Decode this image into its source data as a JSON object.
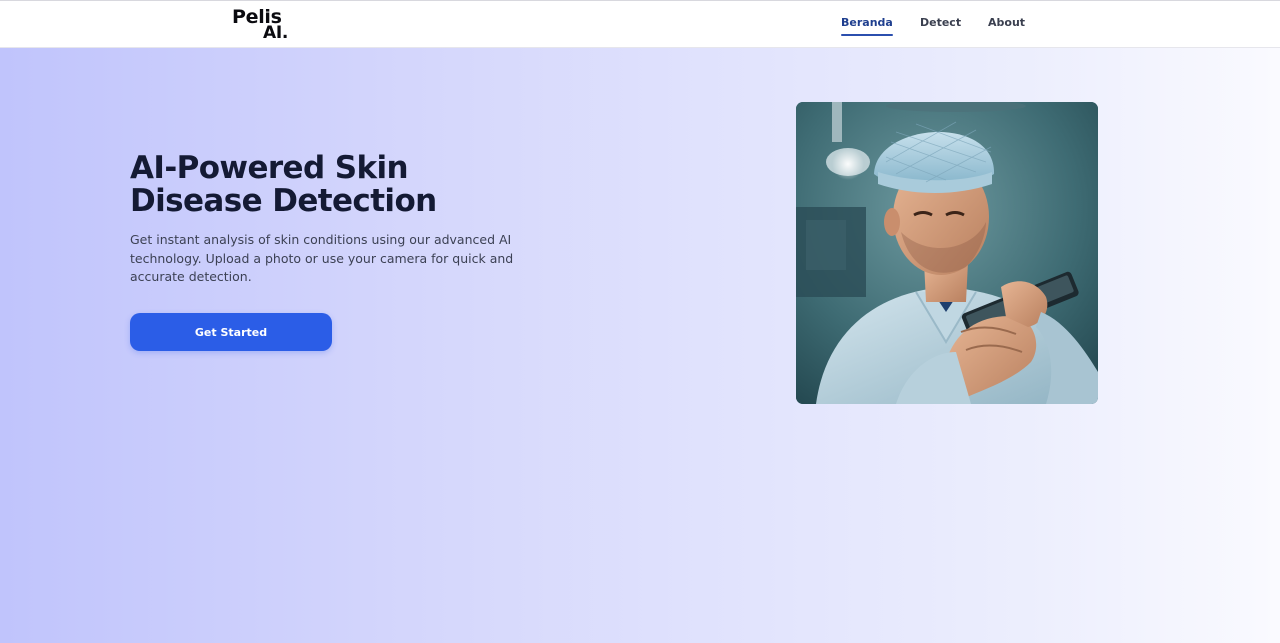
{
  "header": {
    "logo_line1": "Pelis",
    "logo_line2": "AI.",
    "nav": [
      {
        "label": "Beranda",
        "active": true
      },
      {
        "label": "Detect",
        "active": false
      },
      {
        "label": "About",
        "active": false
      }
    ]
  },
  "hero": {
    "title_line1": "AI-Powered Skin",
    "title_line2": "Disease Detection",
    "description": "Get instant analysis of skin conditions using our advanced AI technology. Upload a photo or use your camera for quick and accurate detection.",
    "cta_label": "Get Started",
    "image_subject": "doctor-with-tablet"
  },
  "colors": {
    "accent": "#2b5de7",
    "nav_active": "#1f3f8f",
    "title": "#141a34",
    "gradient_start": "#c0c4fc",
    "gradient_end": "#fafaff"
  }
}
